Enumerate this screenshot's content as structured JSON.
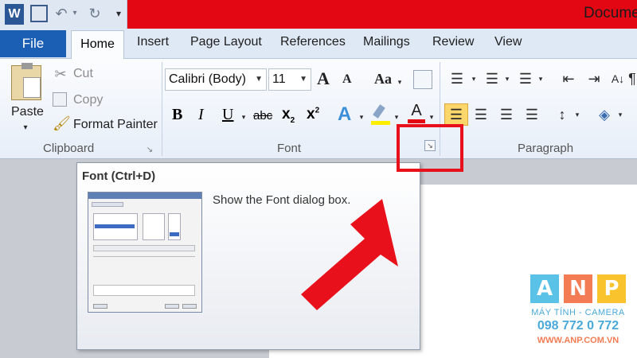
{
  "window": {
    "title": "Docume"
  },
  "quick_access": {
    "app_icon": "word-icon",
    "save_icon": "save-icon",
    "undo_icon": "undo-icon",
    "redo_icon": "redo-icon"
  },
  "tabs": {
    "file": "File",
    "home": "Home",
    "items": [
      "Insert",
      "Page Layout",
      "References",
      "Mailings",
      "Review",
      "View"
    ]
  },
  "clipboard": {
    "paste": "Paste",
    "cut": "Cut",
    "copy": "Copy",
    "format_painter": "Format Painter",
    "group_label": "Clipboard"
  },
  "font": {
    "font_name": "Calibri (Body)",
    "font_size": "11",
    "grow": "A",
    "shrink": "A",
    "change_case": "Aa",
    "bold": "B",
    "italic": "I",
    "underline": "U",
    "strike": "abc",
    "subscript": "x",
    "sub_mark": "2",
    "superscript": "x",
    "sup_mark": "2",
    "font_color": "A",
    "group_label": "Font"
  },
  "paragraph": {
    "group_label": "Paragraph"
  },
  "tooltip": {
    "title": "Font (Ctrl+D)",
    "description": "Show the Font dialog box."
  },
  "logo": {
    "letters": [
      "A",
      "N",
      "P"
    ],
    "colors": [
      "#5bc2e7",
      "#f47c54",
      "#f8c32c"
    ],
    "line1": "MÁY TÍNH - CAMERA",
    "line2": "098 772 0 772",
    "line3": "WWW.ANP.COM.VN"
  },
  "accent_colors": {
    "title_bar": "#e30613",
    "file_tab": "#1a5fb4",
    "callout": "#e8111b"
  }
}
